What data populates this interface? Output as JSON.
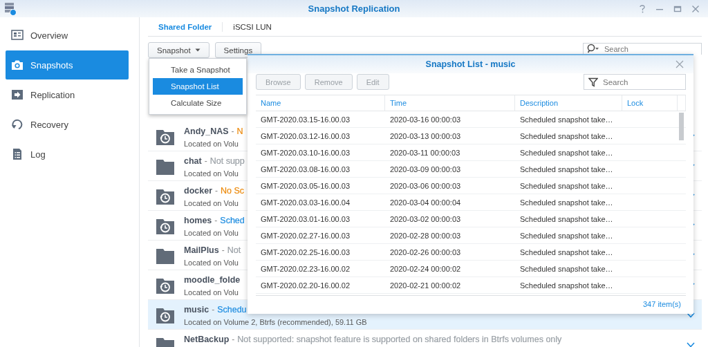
{
  "window": {
    "title": "Snapshot Replication"
  },
  "sidebar": {
    "items": [
      {
        "label": "Overview",
        "kind": "overview",
        "selected": false
      },
      {
        "label": "Snapshots",
        "kind": "camera",
        "selected": true
      },
      {
        "label": "Replication",
        "kind": "replication",
        "selected": false
      },
      {
        "label": "Recovery",
        "kind": "recovery",
        "selected": false
      },
      {
        "label": "Log",
        "kind": "log",
        "selected": false
      }
    ]
  },
  "tabs": [
    {
      "label": "Shared Folder",
      "selected": true
    },
    {
      "label": "iSCSI LUN",
      "selected": false
    }
  ],
  "toolbar": {
    "buttons": [
      {
        "label": "Snapshot",
        "kind": "dropdown"
      },
      {
        "label": "Settings",
        "kind": "plain"
      }
    ],
    "search": {
      "placeholder": "Search"
    }
  },
  "snapshot_menu": {
    "items": [
      {
        "label": "Take a Snapshot",
        "selected": false
      },
      {
        "label": "Snapshot List",
        "selected": true
      },
      {
        "label": "Calculate Size",
        "selected": false
      }
    ]
  },
  "folders": [
    {
      "kind": "snapshot",
      "name": "Andy_NAS",
      "status": {
        "separator": "-",
        "text": "N",
        "color": "#ec8a0c"
      },
      "location": "Located on Volu",
      "selected": false
    },
    {
      "kind": "plain",
      "name": "chat",
      "status": {
        "separator": "-",
        "text": "Not supp",
        "color": "#9aa0a6"
      },
      "location": "Located on Volu",
      "selected": false
    },
    {
      "kind": "snapshot",
      "name": "docker",
      "status": {
        "separator": "-",
        "text": "No Sc",
        "color": "#ec8a0c"
      },
      "location": "Located on Volu",
      "selected": false
    },
    {
      "kind": "snapshot",
      "name": "homes",
      "status": {
        "separator": "-",
        "text": "Sched",
        "color": "#1a8be0"
      },
      "location": "Located on Volu",
      "selected": false
    },
    {
      "kind": "plain",
      "name": "MailPlus",
      "status": {
        "separator": "-",
        "text": "Not",
        "color": "#9aa0a6"
      },
      "location": "Located on Volu",
      "selected": false
    },
    {
      "kind": "snapshot",
      "name": "moodle_folde",
      "location": "Located on Volu",
      "selected": false
    },
    {
      "kind": "snapshot",
      "name": "music",
      "status": {
        "separator": "-",
        "text": "Schedu",
        "color": "#1a8be0"
      },
      "location": "Located on Volume 2, Btrfs (recommended), 59.11 GB",
      "selected": true
    },
    {
      "kind": "plain",
      "name": "NetBackup",
      "status": {
        "separator": "-",
        "text": "Not supported: snapshot feature is supported on shared folders in Btrfs volumes only",
        "color": "#9aa0a6"
      },
      "selected": false
    }
  ],
  "dialog": {
    "title": "Snapshot List - music",
    "buttons": [
      {
        "label": "Browse",
        "disabled": true
      },
      {
        "label": "Remove",
        "disabled": true
      },
      {
        "label": "Edit",
        "disabled": true
      }
    ],
    "search": {
      "placeholder": "Search"
    },
    "columns": [
      "Name",
      "Time",
      "Description",
      "Lock"
    ],
    "rows": [
      [
        "GMT-2020.03.15-16.00.03",
        "2020-03-16 00:00:03",
        "Scheduled snapshot take…"
      ],
      [
        "GMT-2020.03.12-16.00.03",
        "2020-03-13 00:00:03",
        "Scheduled snapshot take…"
      ],
      [
        "GMT-2020.03.10-16.00.03",
        "2020-03-11 00:00:03",
        "Scheduled snapshot take…"
      ],
      [
        "GMT-2020.03.08-16.00.03",
        "2020-03-09 00:00:03",
        "Scheduled snapshot take…"
      ],
      [
        "GMT-2020.03.05-16.00.03",
        "2020-03-06 00:00:03",
        "Scheduled snapshot take…"
      ],
      [
        "GMT-2020.03.03-16.00.04",
        "2020-03-04 00:00:04",
        "Scheduled snapshot take…"
      ],
      [
        "GMT-2020.03.01-16.00.03",
        "2020-03-02 00:00:03",
        "Scheduled snapshot take…"
      ],
      [
        "GMT-2020.02.27-16.00.03",
        "2020-02-28 00:00:03",
        "Scheduled snapshot take…"
      ],
      [
        "GMT-2020.02.25-16.00.03",
        "2020-02-26 00:00:03",
        "Scheduled snapshot take…"
      ],
      [
        "GMT-2020.02.23-16.00.02",
        "2020-02-24 00:00:02",
        "Scheduled snapshot take…"
      ],
      [
        "GMT-2020.02.20-16.00.02",
        "2020-02-21 00:00:02",
        "Scheduled snapshot take…"
      ]
    ],
    "footer": "347 item(s)"
  }
}
